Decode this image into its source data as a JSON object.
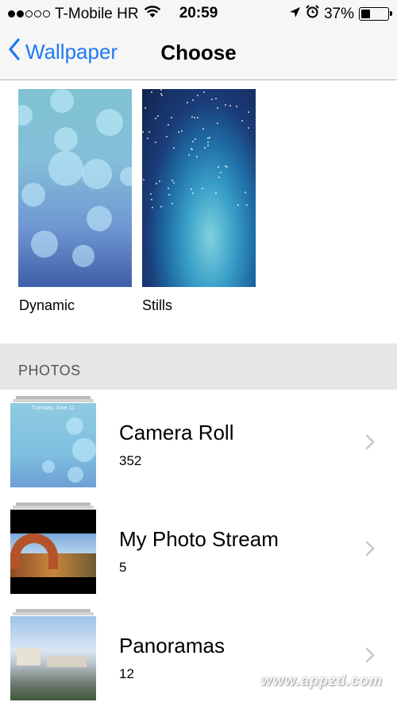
{
  "status_bar": {
    "signal_dots_filled": 2,
    "signal_dots_total": 5,
    "carrier": "T-Mobile HR",
    "time": "20:59",
    "battery": "37%",
    "battery_level": 0.37
  },
  "nav": {
    "back_label": "Wallpaper",
    "title": "Choose"
  },
  "wallpapers": [
    {
      "label": "Dynamic"
    },
    {
      "label": "Stills"
    }
  ],
  "photos_section": {
    "header": "PHOTOS",
    "albums": [
      {
        "title": "Camera Roll",
        "count": "352",
        "thumb_caption": "Tuesday, June 11"
      },
      {
        "title": "My Photo Stream",
        "count": "5"
      },
      {
        "title": "Panoramas",
        "count": "12"
      }
    ]
  },
  "watermark": "www.appzd.com",
  "colors": {
    "accent": "#1d7af2",
    "section_bg": "#e6e6e9",
    "chevron": "#c7c7cc"
  }
}
